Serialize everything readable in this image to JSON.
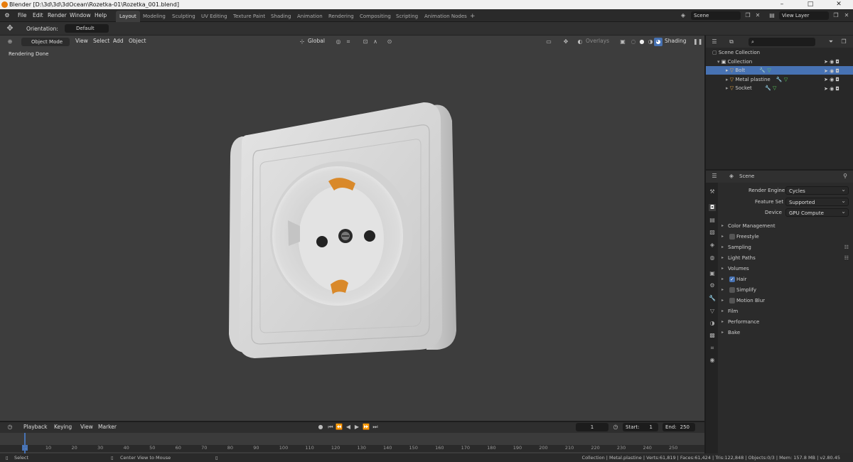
{
  "window": {
    "title": "Blender [D:\\3d\\3d\\3dOcean\\Rozetka-01\\Rozetka_001.blend]"
  },
  "menu": [
    "File",
    "Edit",
    "Render",
    "Window",
    "Help"
  ],
  "workspaces": [
    "Layout",
    "Modeling",
    "Sculpting",
    "UV Editing",
    "Texture Paint",
    "Shading",
    "Animation",
    "Rendering",
    "Compositing",
    "Scripting",
    "Animation Nodes"
  ],
  "active_workspace": "Layout",
  "add_workspace": "+",
  "scene": {
    "label": "Scene",
    "view_layer": "View Layer"
  },
  "tool_settings": {
    "orientation_label": "Orientation:",
    "orientation_value": "Default"
  },
  "viewport": {
    "mode": "Object Mode",
    "menus": [
      "View",
      "Select",
      "Add",
      "Object"
    ],
    "transform": "Global",
    "overlays": "Overlays",
    "shading": "Shading",
    "status_text": "Rendering Done"
  },
  "outliner": {
    "search_placeholder": "",
    "scene_collection": "Scene Collection",
    "collection": "Collection",
    "items": [
      {
        "name": "Bolt",
        "selected": true
      },
      {
        "name": "Metal plastine",
        "selected": false
      },
      {
        "name": "Socket",
        "selected": false
      }
    ]
  },
  "properties": {
    "header": "Scene",
    "render_engine_label": "Render Engine",
    "render_engine": "Cycles",
    "feature_set_label": "Feature Set",
    "feature_set": "Supported",
    "device_label": "Device",
    "device": "GPU Compute",
    "panels": [
      {
        "label": "Color Management",
        "type": "section"
      },
      {
        "label": "Freestyle",
        "type": "check",
        "checked": false
      },
      {
        "label": "Sampling",
        "type": "section",
        "list": true
      },
      {
        "label": "Light Paths",
        "type": "section",
        "list": true
      },
      {
        "label": "Volumes",
        "type": "section"
      },
      {
        "label": "Hair",
        "type": "check",
        "checked": true
      },
      {
        "label": "Simplify",
        "type": "check",
        "checked": false
      },
      {
        "label": "Motion Blur",
        "type": "check",
        "checked": false
      },
      {
        "label": "Film",
        "type": "section"
      },
      {
        "label": "Performance",
        "type": "section"
      },
      {
        "label": "Bake",
        "type": "section"
      }
    ]
  },
  "timeline": {
    "menus": [
      "Playback",
      "Keying",
      "View",
      "Marker"
    ],
    "current_frame": "1",
    "start_label": "Start:",
    "start": "1",
    "end_label": "End:",
    "end": "250",
    "ticks": [
      "1",
      "10",
      "20",
      "30",
      "40",
      "50",
      "60",
      "70",
      "80",
      "90",
      "100",
      "110",
      "120",
      "130",
      "140",
      "150",
      "160",
      "170",
      "180",
      "190",
      "200",
      "210",
      "220",
      "230",
      "240",
      "250"
    ]
  },
  "status": {
    "select": "Select",
    "center_view": "Center View to Mouse",
    "stats": "Collection | Metal.plastine | Verts:61,819 | Faces:61,424 | Tris:122,848 | Objects:0/3 | Mem: 157.8 MB | v2.80.45"
  },
  "colors": {
    "accent": "#4772b3",
    "viewport_bg": "#3d3d3d",
    "object_orange": "#e8a33d"
  }
}
